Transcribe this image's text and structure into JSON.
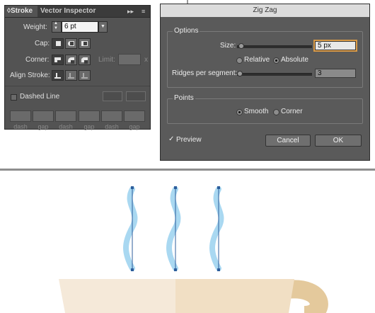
{
  "stroke_panel": {
    "tabs": [
      {
        "label": "◊Stroke",
        "active": true
      },
      {
        "label": "Vector Inspector",
        "active": false
      }
    ],
    "tab_controls": {
      "collapse": "▸▸",
      "menu": "≡"
    },
    "weight": {
      "label": "Weight:",
      "value": "6 pt",
      "stepper_up": "▲",
      "stepper_down": "▼",
      "dropdown": "▼"
    },
    "cap": {
      "label": "Cap:",
      "icons": [
        "butt-cap-icon",
        "round-cap-icon",
        "projecting-cap-icon"
      ],
      "selected": 0
    },
    "corner": {
      "label": "Corner:",
      "icons": [
        "miter-join-icon",
        "round-join-icon",
        "bevel-join-icon"
      ],
      "selected": 0
    },
    "limit": {
      "label": "Limit:",
      "value": "",
      "suffix": "x"
    },
    "align_stroke": {
      "label": "Align Stroke:",
      "icons": [
        "align-center-icon",
        "align-inside-icon",
        "align-outside-icon"
      ],
      "selected": 0
    },
    "dashed_line": {
      "label": "Dashed Line",
      "checked": false
    },
    "dash_fields": [
      {
        "label": "dash",
        "value": ""
      },
      {
        "label": "gap",
        "value": ""
      },
      {
        "label": "dash",
        "value": ""
      },
      {
        "label": "gap",
        "value": ""
      },
      {
        "label": "dash",
        "value": ""
      },
      {
        "label": "gap",
        "value": ""
      }
    ]
  },
  "zigzag_dialog": {
    "title": "Zig Zag",
    "options_group": {
      "title": "Options",
      "size": {
        "label": "Size:",
        "value": "5 px",
        "slider": 0.03
      },
      "mode_options": [
        {
          "label": "Relative",
          "selected": false
        },
        {
          "label": "Absolute",
          "selected": true
        }
      ],
      "ridges": {
        "label": "Ridges per segment:",
        "value": "3",
        "slider": 0.03
      }
    },
    "points_group": {
      "title": "Points",
      "options": [
        {
          "label": "Smooth",
          "selected": true
        },
        {
          "label": "Corner",
          "selected": false
        }
      ]
    },
    "preview": {
      "label": "Preview",
      "checked": true,
      "check_glyph": "✓"
    },
    "buttons": {
      "cancel": "Cancel",
      "ok": "OK"
    }
  },
  "illustration": {
    "steam_color": "#a9d8f1",
    "path_color": "#2d5d9b",
    "cup_left_color": "#f5e9d9",
    "cup_right_color": "#f1dfc4",
    "handle_color": "#e4c99c",
    "steam_count": 3
  }
}
